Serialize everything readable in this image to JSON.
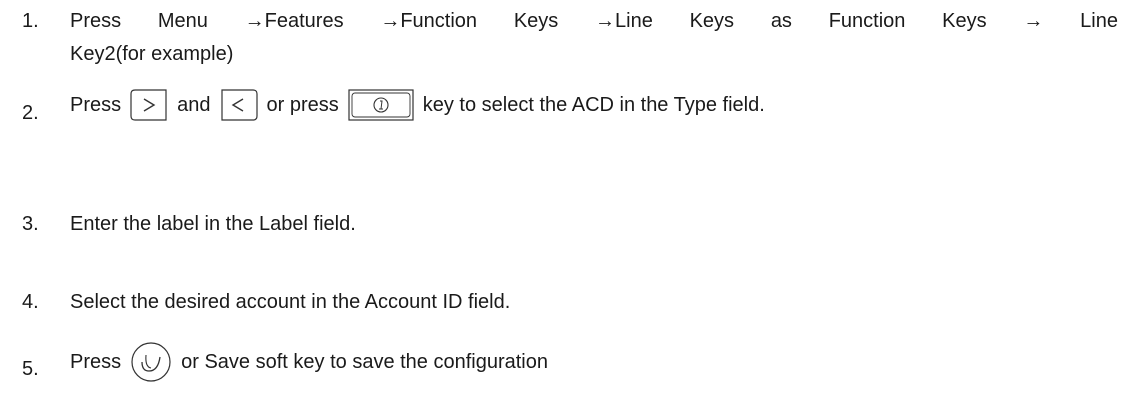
{
  "steps": [
    {
      "number": "1.",
      "line1_words": [
        "Press",
        "Menu",
        "→Features",
        "→Function",
        "Keys",
        "→Line",
        "Keys",
        "as",
        "Function",
        "Keys",
        "→",
        "Line"
      ],
      "line2": "Key2(for example)"
    },
    {
      "number": "2.",
      "part_press": "Press",
      "part_and": "and",
      "part_or_press": "or press",
      "part_rest": "key to select the ACD in the Type field.",
      "icons": [
        "right-arrow-key-icon",
        "left-arrow-key-icon",
        "ok-info-key-icon"
      ]
    },
    {
      "number": "3.",
      "text": "Enter the label in the Label field."
    },
    {
      "number": "4.",
      "text": "Select the desired account in the Account ID field."
    },
    {
      "number": "5.",
      "part_press": "Press",
      "part_rest": "or Save soft key to save the configuration",
      "icons": [
        "ok-check-key-icon"
      ]
    }
  ]
}
